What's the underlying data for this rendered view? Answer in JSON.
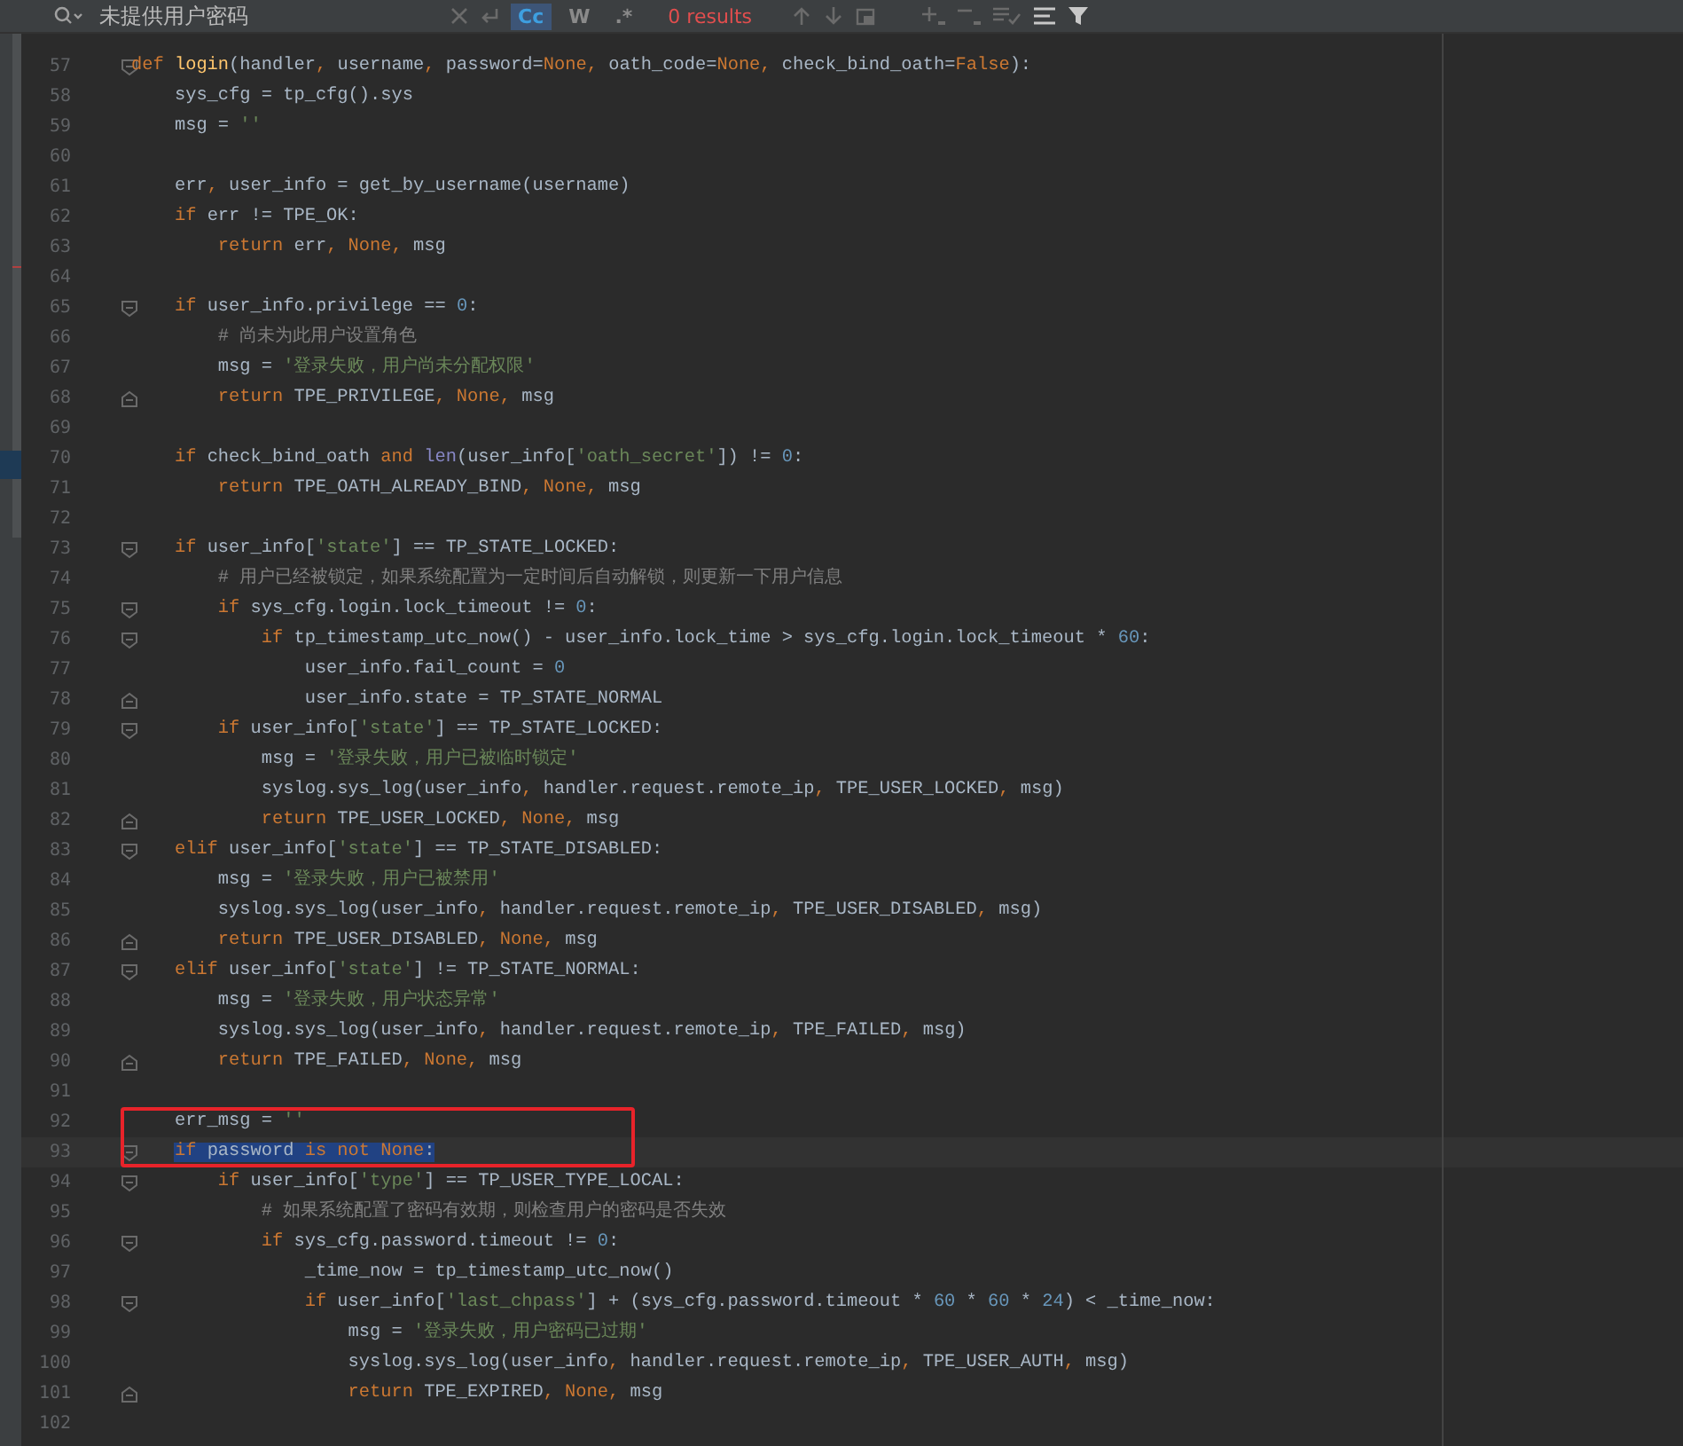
{
  "search_bar": {
    "query": "未提供用户密码",
    "options": [
      {
        "label": "Cc",
        "selected": true
      },
      {
        "label": "W",
        "selected": false
      },
      {
        "label": ".*",
        "selected": false
      }
    ],
    "results": "0 results"
  },
  "editor": {
    "lines": [
      {
        "number": "57",
        "fold_start": true,
        "tokens": [
          {
            "kind": "kw",
            "text": "def "
          },
          {
            "kind": "fn",
            "text": "login"
          },
          {
            "kind": "t",
            "text": "(handler"
          },
          {
            "kind": "kw",
            "text": ", "
          },
          {
            "kind": "t",
            "text": "username"
          },
          {
            "kind": "kw",
            "text": ", "
          },
          {
            "kind": "t",
            "text": "password="
          },
          {
            "kind": "kw",
            "text": "None, "
          },
          {
            "kind": "t",
            "text": "oath_code="
          },
          {
            "kind": "kw",
            "text": "None, "
          },
          {
            "kind": "t",
            "text": "check_bind_oath="
          },
          {
            "kind": "kw",
            "text": "False"
          },
          {
            "kind": "t",
            "text": "):"
          }
        ]
      },
      {
        "number": "58",
        "tokens": [
          {
            "kind": "t",
            "text": "    sys_cfg = tp_cfg().sys"
          }
        ]
      },
      {
        "number": "59",
        "tokens": [
          {
            "kind": "t",
            "text": "    msg = "
          },
          {
            "kind": "str",
            "text": "''"
          }
        ]
      },
      {
        "number": "60"
      },
      {
        "number": "61",
        "tokens": [
          {
            "kind": "t",
            "text": "    err"
          },
          {
            "kind": "kw",
            "text": ", "
          },
          {
            "kind": "t",
            "text": "user_info = get_by_username(username)"
          }
        ]
      },
      {
        "number": "62",
        "tokens": [
          {
            "kind": "kw",
            "text": "    if "
          },
          {
            "kind": "t",
            "text": "err != TPE_OK:"
          }
        ]
      },
      {
        "number": "63",
        "tokens": [
          {
            "kind": "kw",
            "text": "        return "
          },
          {
            "kind": "t",
            "text": "err"
          },
          {
            "kind": "kw",
            "text": ", None, "
          },
          {
            "kind": "t",
            "text": "msg"
          }
        ]
      },
      {
        "number": "64"
      },
      {
        "number": "65",
        "fold_start": true,
        "tokens": [
          {
            "kind": "kw",
            "text": "    if "
          },
          {
            "kind": "t",
            "text": "user_info.privilege == "
          },
          {
            "kind": "num",
            "text": "0"
          },
          {
            "kind": "t",
            "text": ":"
          }
        ]
      },
      {
        "number": "66",
        "tokens": [
          {
            "kind": "cm",
            "text": "        # 尚未为此用户设置角色"
          }
        ]
      },
      {
        "number": "67",
        "tokens": [
          {
            "kind": "t",
            "text": "        msg = "
          },
          {
            "kind": "str",
            "text": "'登录失败，用户尚未分配权限'"
          }
        ]
      },
      {
        "number": "68",
        "fold_end": true,
        "tokens": [
          {
            "kind": "kw",
            "text": "        return "
          },
          {
            "kind": "t",
            "text": "TPE_PRIVILEGE"
          },
          {
            "kind": "kw",
            "text": ", None, "
          },
          {
            "kind": "t",
            "text": "msg"
          }
        ]
      },
      {
        "number": "69"
      },
      {
        "number": "70",
        "tokens": [
          {
            "kind": "kw",
            "text": "    if "
          },
          {
            "kind": "t",
            "text": "check_bind_oath "
          },
          {
            "kind": "kw",
            "text": "and "
          },
          {
            "kind": "bi",
            "text": "len"
          },
          {
            "kind": "t",
            "text": "(user_info["
          },
          {
            "kind": "str",
            "text": "'oath_secret'"
          },
          {
            "kind": "t",
            "text": "]) != "
          },
          {
            "kind": "num",
            "text": "0"
          },
          {
            "kind": "t",
            "text": ":"
          }
        ]
      },
      {
        "number": "71",
        "tokens": [
          {
            "kind": "kw",
            "text": "        return "
          },
          {
            "kind": "t",
            "text": "TPE_OATH_ALREADY_BIND"
          },
          {
            "kind": "kw",
            "text": ", None, "
          },
          {
            "kind": "t",
            "text": "msg"
          }
        ]
      },
      {
        "number": "72"
      },
      {
        "number": "73",
        "fold_start": true,
        "tokens": [
          {
            "kind": "kw",
            "text": "    if "
          },
          {
            "kind": "t",
            "text": "user_info["
          },
          {
            "kind": "str",
            "text": "'state'"
          },
          {
            "kind": "t",
            "text": "] == TP_STATE_LOCKED:"
          }
        ]
      },
      {
        "number": "74",
        "tokens": [
          {
            "kind": "cm",
            "text": "        # 用户已经被锁定，如果系统配置为一定时间后自动解锁，则更新一下用户信息"
          }
        ]
      },
      {
        "number": "75",
        "fold_start": true,
        "tokens": [
          {
            "kind": "kw",
            "text": "        if "
          },
          {
            "kind": "t",
            "text": "sys_cfg.login.lock_timeout != "
          },
          {
            "kind": "num",
            "text": "0"
          },
          {
            "kind": "t",
            "text": ":"
          }
        ]
      },
      {
        "number": "76",
        "fold_start": true,
        "tokens": [
          {
            "kind": "kw",
            "text": "            if "
          },
          {
            "kind": "t",
            "text": "tp_timestamp_utc_now() - user_info.lock_time > sys_cfg.login.lock_timeout * "
          },
          {
            "kind": "num",
            "text": "60"
          },
          {
            "kind": "t",
            "text": ":"
          }
        ]
      },
      {
        "number": "77",
        "tokens": [
          {
            "kind": "t",
            "text": "                user_info.fail_count = "
          },
          {
            "kind": "num",
            "text": "0"
          }
        ]
      },
      {
        "number": "78",
        "fold_end": true,
        "tokens": [
          {
            "kind": "t",
            "text": "                user_info.state = TP_STATE_NORMAL"
          }
        ]
      },
      {
        "number": "79",
        "fold_start": true,
        "tokens": [
          {
            "kind": "kw",
            "text": "        if "
          },
          {
            "kind": "t",
            "text": "user_info["
          },
          {
            "kind": "str",
            "text": "'state'"
          },
          {
            "kind": "t",
            "text": "] == TP_STATE_LOCKED:"
          }
        ]
      },
      {
        "number": "80",
        "tokens": [
          {
            "kind": "t",
            "text": "            msg = "
          },
          {
            "kind": "str",
            "text": "'登录失败，用户已被临时锁定'"
          }
        ]
      },
      {
        "number": "81",
        "tokens": [
          {
            "kind": "t",
            "text": "            syslog.sys_log(user_info"
          },
          {
            "kind": "kw",
            "text": ", "
          },
          {
            "kind": "t",
            "text": "handler.request.remote_ip"
          },
          {
            "kind": "kw",
            "text": ", "
          },
          {
            "kind": "t",
            "text": "TPE_USER_LOCKED"
          },
          {
            "kind": "kw",
            "text": ", "
          },
          {
            "kind": "t",
            "text": "msg)"
          }
        ]
      },
      {
        "number": "82",
        "fold_end": true,
        "tokens": [
          {
            "kind": "kw",
            "text": "            return "
          },
          {
            "kind": "t",
            "text": "TPE_USER_LOCKED"
          },
          {
            "kind": "kw",
            "text": ", None, "
          },
          {
            "kind": "t",
            "text": "msg"
          }
        ]
      },
      {
        "number": "83",
        "fold_start": true,
        "tokens": [
          {
            "kind": "kw",
            "text": "    elif "
          },
          {
            "kind": "t",
            "text": "user_info["
          },
          {
            "kind": "str",
            "text": "'state'"
          },
          {
            "kind": "t",
            "text": "] == TP_STATE_DISABLED:"
          }
        ]
      },
      {
        "number": "84",
        "tokens": [
          {
            "kind": "t",
            "text": "        msg = "
          },
          {
            "kind": "str",
            "text": "'登录失败，用户已被禁用'"
          }
        ]
      },
      {
        "number": "85",
        "tokens": [
          {
            "kind": "t",
            "text": "        syslog.sys_log(user_info"
          },
          {
            "kind": "kw",
            "text": ", "
          },
          {
            "kind": "t",
            "text": "handler.request.remote_ip"
          },
          {
            "kind": "kw",
            "text": ", "
          },
          {
            "kind": "t",
            "text": "TPE_USER_DISABLED"
          },
          {
            "kind": "kw",
            "text": ", "
          },
          {
            "kind": "t",
            "text": "msg)"
          }
        ]
      },
      {
        "number": "86",
        "fold_end": true,
        "tokens": [
          {
            "kind": "kw",
            "text": "        return "
          },
          {
            "kind": "t",
            "text": "TPE_USER_DISABLED"
          },
          {
            "kind": "kw",
            "text": ", None, "
          },
          {
            "kind": "t",
            "text": "msg"
          }
        ]
      },
      {
        "number": "87",
        "fold_start": true,
        "tokens": [
          {
            "kind": "kw",
            "text": "    elif "
          },
          {
            "kind": "t",
            "text": "user_info["
          },
          {
            "kind": "str",
            "text": "'state'"
          },
          {
            "kind": "t",
            "text": "] != TP_STATE_NORMAL:"
          }
        ]
      },
      {
        "number": "88",
        "tokens": [
          {
            "kind": "t",
            "text": "        msg = "
          },
          {
            "kind": "str",
            "text": "'登录失败，用户状态异常'"
          }
        ]
      },
      {
        "number": "89",
        "tokens": [
          {
            "kind": "t",
            "text": "        syslog.sys_log(user_info"
          },
          {
            "kind": "kw",
            "text": ", "
          },
          {
            "kind": "t",
            "text": "handler.request.remote_ip"
          },
          {
            "kind": "kw",
            "text": ", "
          },
          {
            "kind": "t",
            "text": "TPE_FAILED"
          },
          {
            "kind": "kw",
            "text": ", "
          },
          {
            "kind": "t",
            "text": "msg)"
          }
        ]
      },
      {
        "number": "90",
        "fold_end": true,
        "tokens": [
          {
            "kind": "kw",
            "text": "        return "
          },
          {
            "kind": "t",
            "text": "TPE_FAILED"
          },
          {
            "kind": "kw",
            "text": ", None, "
          },
          {
            "kind": "t",
            "text": "msg"
          }
        ]
      },
      {
        "number": "91"
      },
      {
        "number": "92",
        "boxed": true,
        "tokens": [
          {
            "kind": "t",
            "text": "    err_msg = "
          },
          {
            "kind": "str",
            "text": "''"
          }
        ]
      },
      {
        "number": "93",
        "fold_start": true,
        "boxed": true,
        "highlighted": true,
        "tokens": [
          {
            "kind": "kw",
            "text": "    if "
          },
          {
            "kind": "t",
            "text": "password "
          },
          {
            "kind": "kw",
            "text": "is not None"
          },
          {
            "kind": "t",
            "text": ":"
          }
        ]
      },
      {
        "number": "94",
        "fold_start": true,
        "tokens": [
          {
            "kind": "kw",
            "text": "        if "
          },
          {
            "kind": "t",
            "text": "user_info["
          },
          {
            "kind": "str",
            "text": "'type'"
          },
          {
            "kind": "t",
            "text": "] == TP_USER_TYPE_LOCAL:"
          }
        ]
      },
      {
        "number": "95",
        "tokens": [
          {
            "kind": "cm",
            "text": "            # 如果系统配置了密码有效期，则检查用户的密码是否失效"
          }
        ]
      },
      {
        "number": "96",
        "fold_start": true,
        "tokens": [
          {
            "kind": "kw",
            "text": "            if "
          },
          {
            "kind": "t",
            "text": "sys_cfg.password.timeout != "
          },
          {
            "kind": "num",
            "text": "0"
          },
          {
            "kind": "t",
            "text": ":"
          }
        ]
      },
      {
        "number": "97",
        "tokens": [
          {
            "kind": "t",
            "text": "                _time_now = tp_timestamp_utc_now()"
          }
        ]
      },
      {
        "number": "98",
        "fold_start": true,
        "tokens": [
          {
            "kind": "kw",
            "text": "                if "
          },
          {
            "kind": "t",
            "text": "user_info["
          },
          {
            "kind": "str",
            "text": "'last_chpass'"
          },
          {
            "kind": "t",
            "text": "] + (sys_cfg.password.timeout * "
          },
          {
            "kind": "num",
            "text": "60"
          },
          {
            "kind": "t",
            "text": " * "
          },
          {
            "kind": "num",
            "text": "60"
          },
          {
            "kind": "t",
            "text": " * "
          },
          {
            "kind": "num",
            "text": "24"
          },
          {
            "kind": "t",
            "text": ") < _time_now:"
          }
        ]
      },
      {
        "number": "99",
        "tokens": [
          {
            "kind": "t",
            "text": "                    msg = "
          },
          {
            "kind": "str",
            "text": "'登录失败，用户密码已过期'"
          }
        ]
      },
      {
        "number": "100",
        "tokens": [
          {
            "kind": "t",
            "text": "                    syslog.sys_log(user_info"
          },
          {
            "kind": "kw",
            "text": ", "
          },
          {
            "kind": "t",
            "text": "handler.request.remote_ip"
          },
          {
            "kind": "kw",
            "text": ", "
          },
          {
            "kind": "t",
            "text": "TPE_USER_AUTH"
          },
          {
            "kind": "kw",
            "text": ", "
          },
          {
            "kind": "t",
            "text": "msg)"
          }
        ]
      },
      {
        "number": "101",
        "fold_end": true,
        "tokens": [
          {
            "kind": "kw",
            "text": "                    return "
          },
          {
            "kind": "t",
            "text": "TPE_EXPIRED"
          },
          {
            "kind": "kw",
            "text": ", None, "
          },
          {
            "kind": "t",
            "text": "msg"
          }
        ]
      },
      {
        "number": "102"
      }
    ]
  }
}
